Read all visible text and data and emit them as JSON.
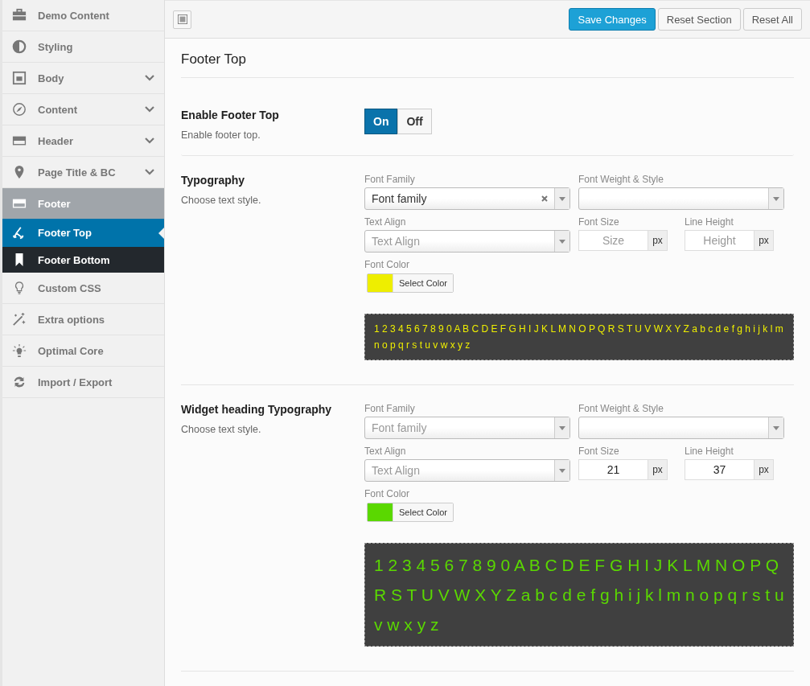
{
  "sidebar": {
    "items": [
      {
        "label": "Demo Content",
        "selected": false,
        "collapsible": false,
        "open": false
      },
      {
        "label": "Styling",
        "selected": false,
        "collapsible": false,
        "open": false
      },
      {
        "label": "Body",
        "selected": false,
        "collapsible": true,
        "open": false
      },
      {
        "label": "Content",
        "selected": false,
        "collapsible": true,
        "open": false
      },
      {
        "label": "Header",
        "selected": false,
        "collapsible": true,
        "open": false
      },
      {
        "label": "Page Title & BC",
        "selected": false,
        "collapsible": true,
        "open": false
      },
      {
        "label": "Footer",
        "selected": false,
        "collapsible": false,
        "open": true,
        "children": [
          {
            "label": "Footer Top",
            "selected": true
          },
          {
            "label": "Footer Bottom",
            "selected": false
          }
        ]
      },
      {
        "label": "Custom CSS",
        "selected": false,
        "collapsible": false,
        "open": false
      },
      {
        "label": "Extra options",
        "selected": false,
        "collapsible": false,
        "open": false
      },
      {
        "label": "Optimal Core",
        "selected": false,
        "collapsible": false,
        "open": false
      },
      {
        "label": "Import / Export",
        "selected": false,
        "collapsible": false,
        "open": false
      }
    ]
  },
  "toolbar": {
    "buttons": [
      {
        "label": "Save Changes",
        "primary": true
      },
      {
        "label": "Reset Section",
        "primary": false
      },
      {
        "label": "Reset All",
        "primary": false
      }
    ]
  },
  "section_title": "Footer Top",
  "fields": [
    {
      "kind": "switch",
      "label": "Enable Footer Top",
      "description": "Enable footer top.",
      "options": [
        {
          "label": "On",
          "selected": true
        },
        {
          "label": "Off",
          "selected": false
        }
      ]
    },
    {
      "kind": "typography",
      "label": "Typography",
      "description": "Choose text style.",
      "font_family": {
        "label": "Font Family",
        "value": "Font family",
        "clearable": true
      },
      "font_weight": {
        "label": "Font Weight & Style"
      },
      "text_align": {
        "label": "Text Align",
        "placeholder": "Text Align"
      },
      "font_size": {
        "label": "Font Size",
        "placeholder": "Size",
        "unit": "px"
      },
      "line_height": {
        "label": "Line Height",
        "placeholder": "Height",
        "unit": "px"
      },
      "font_color": {
        "label": "Font Color",
        "button": "Select Color",
        "color": "#eeee00"
      },
      "preview": "1 2 3 4 5 6 7 8 9 0 A B C D E F G H I J K L M N O P Q R S T U V W X Y Z a b c d e f g h i j k l m n o p q r s t u v w x y z"
    },
    {
      "kind": "typography",
      "label": "Widget heading Typography",
      "description": "Choose text style.",
      "font_family": {
        "label": "Font Family",
        "placeholder": "Font family",
        "clearable": false
      },
      "font_weight": {
        "label": "Font Weight & Style"
      },
      "text_align": {
        "label": "Text Align",
        "placeholder": "Text Align"
      },
      "font_size": {
        "label": "Font Size",
        "value": "21",
        "unit": "px"
      },
      "line_height": {
        "label": "Line Height",
        "value": "37",
        "unit": "px"
      },
      "font_color": {
        "label": "Font Color",
        "button": "Select Color",
        "color": "#5ad800"
      },
      "preview": "1 2 3 4 5 6 7 8 9 0 A B C D E F G H I J K L M N O P Q R S T U V W X Y Z a b c d e f g h i j k l m n o p q r s t u v w x y z"
    }
  ]
}
